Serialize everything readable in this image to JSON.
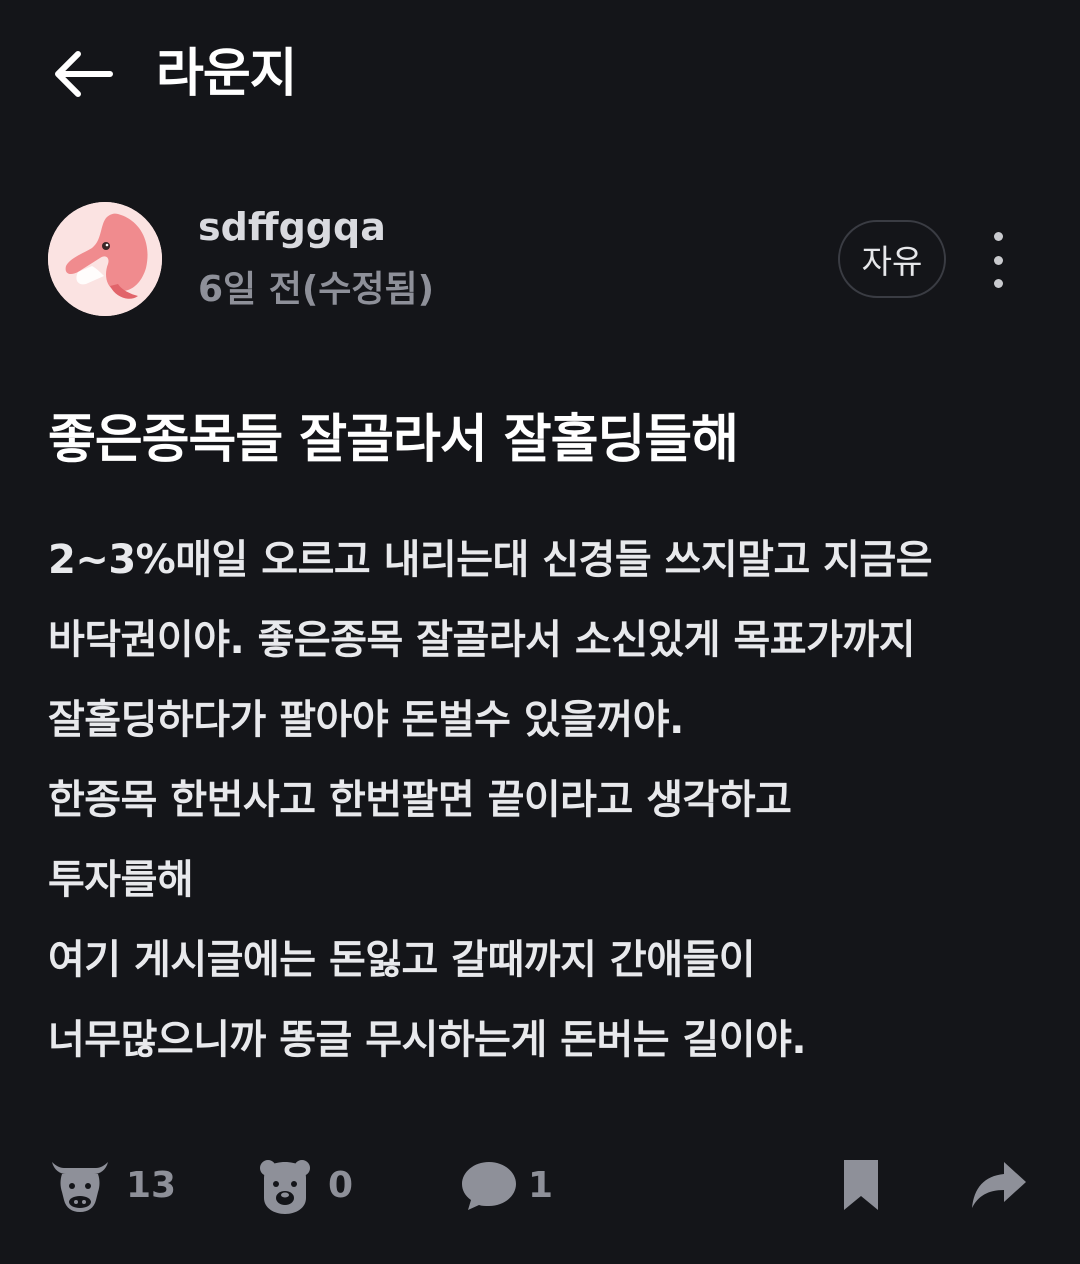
{
  "header": {
    "title": "라운지"
  },
  "author": {
    "username": "sdffggqa",
    "meta": "6일 전(수정됨)",
    "category": "자유"
  },
  "post": {
    "title": "좋은종목들 잘골라서 잘홀딩들해",
    "body": [
      "2~3%매일 오르고 내리는대 신경들 쓰지말고 지금은",
      "바닥권이야. 좋은종목 잘골라서 소신있게 목표가까지",
      "잘홀딩하다가 팔아야 돈벌수 있을꺼야.",
      "한종목 한번사고 한번팔면 끝이라고 생각하고",
      "투자를해",
      "여기 게시글에는 돈잃고 갈때까지 간애들이",
      "너무많으니까 똥글 무시하는게 돈버는 길이야."
    ]
  },
  "actions": {
    "bull_count": "13",
    "bear_count": "0",
    "comment_count": "1"
  },
  "colors": {
    "background": "#141519",
    "icon_gray": "#8e9099",
    "avatar_bg": "#fbe3e2",
    "dolphin_pink": "#f08b8e"
  }
}
